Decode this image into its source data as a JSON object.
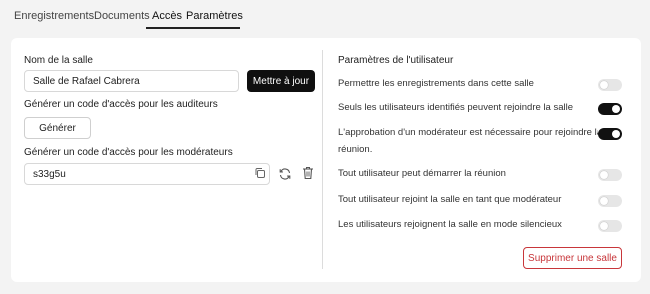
{
  "tabs": [
    {
      "label": "Enregistrements",
      "active": false
    },
    {
      "label": "Documents",
      "active": false
    },
    {
      "label": "Accès",
      "active": true
    },
    {
      "label": "Paramètres",
      "active": true
    }
  ],
  "room": {
    "name_label": "Nom de la salle",
    "name_value": "Salle de Rafael Cabrera",
    "update_button": "Mettre à jour",
    "listener_code_label": "Générer un code d'accès pour les auditeurs",
    "generate_button": "Générer",
    "moderator_code_label": "Générer un code d'accès pour les modérateurs",
    "moderator_code_value": "s33g5u"
  },
  "user_settings": {
    "title": "Paramètres de l'utilisateur",
    "items": [
      {
        "label": "Permettre les enregistrements dans cette salle",
        "enabled": false
      },
      {
        "label": "Seuls les utilisateurs identifiés peuvent rejoindre la salle",
        "enabled": true
      },
      {
        "label": "L'approbation d'un modérateur est nécessaire pour rejoindre la",
        "label_cont": "réunion.",
        "enabled": true
      },
      {
        "label": "Tout utilisateur peut démarrer la réunion",
        "enabled": false
      },
      {
        "label": "Tout utilisateur rejoint la salle en tant que modérateur",
        "enabled": false
      },
      {
        "label": "Les utilisateurs rejoignent la salle en mode silencieux",
        "enabled": false
      }
    ],
    "delete_button": "Supprimer une salle"
  },
  "colors": {
    "danger": "#c8363a",
    "toggle_on": "#111111",
    "toggle_off": "#e6e6e6"
  },
  "icons": {
    "copy": "copy-icon",
    "refresh": "refresh-icon",
    "delete": "trash-icon"
  }
}
